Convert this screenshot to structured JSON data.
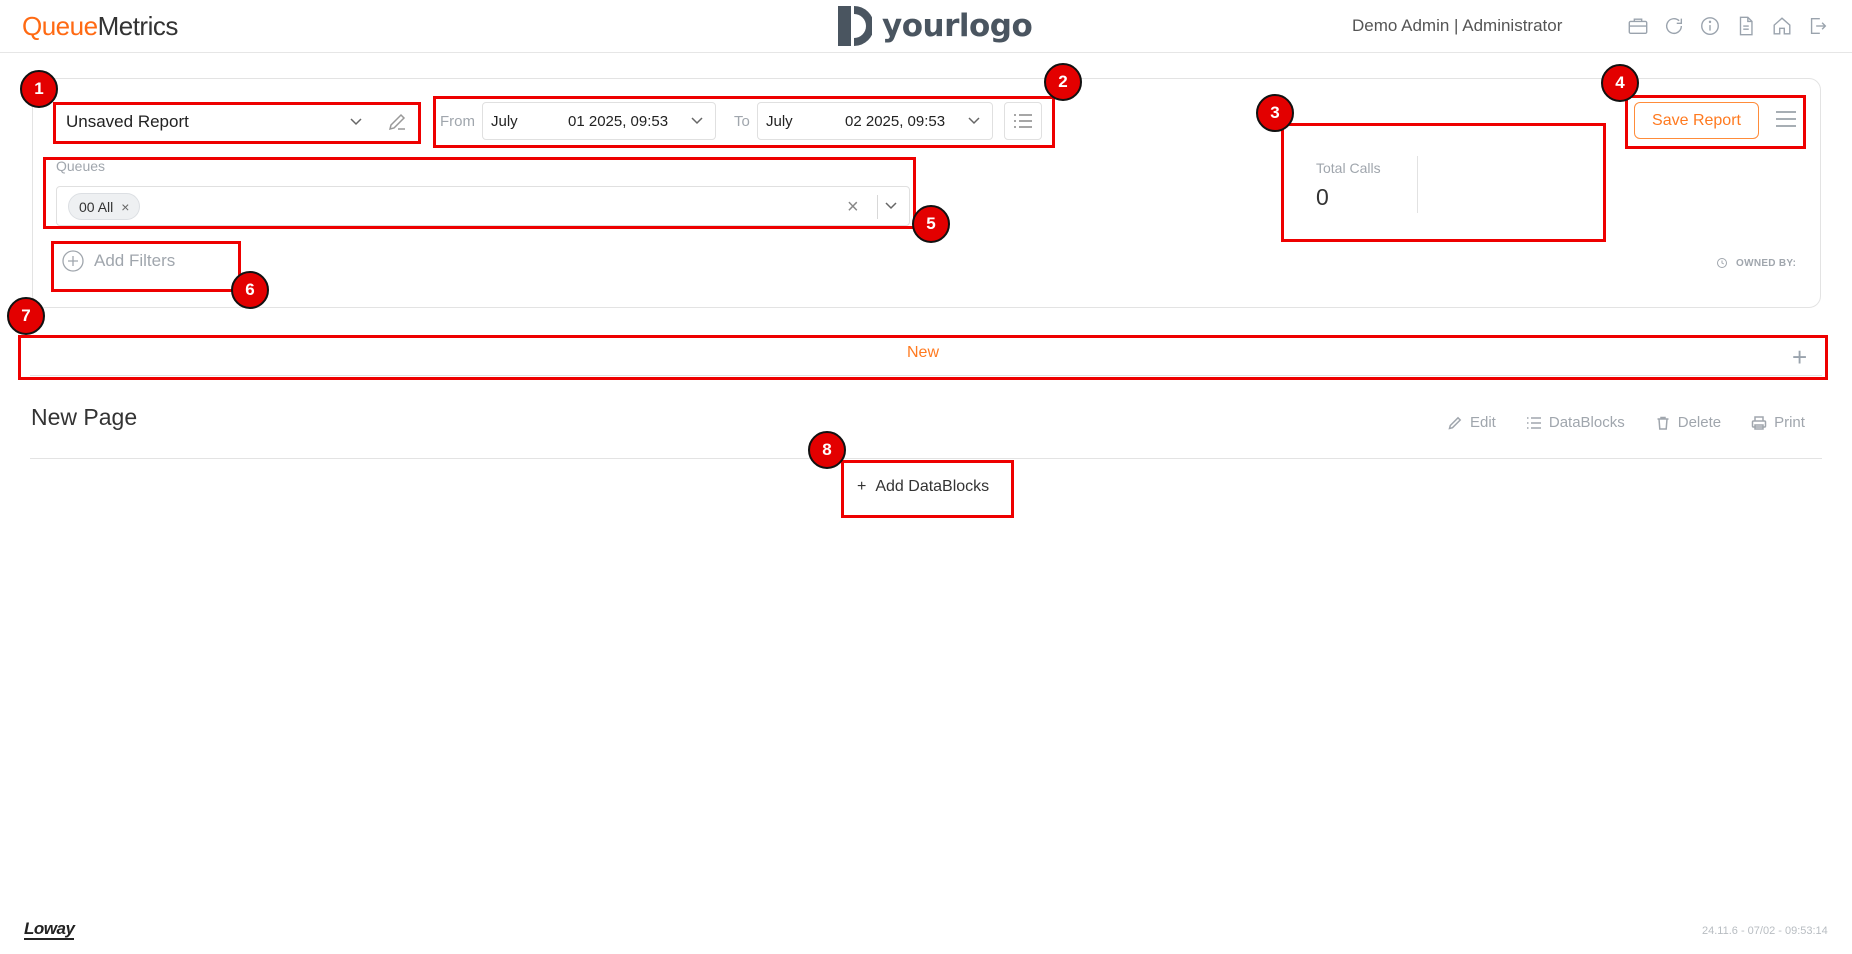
{
  "header": {
    "brand_part1": "Queue",
    "brand_part2": "Metrics",
    "center_logo": "yourlogo",
    "user": "Demo Admin | Administrator",
    "icons": [
      "briefcase-icon",
      "refresh-icon",
      "info-icon",
      "document-icon",
      "home-icon",
      "logout-icon"
    ]
  },
  "report": {
    "name": "Unsaved Report",
    "from_label": "From",
    "to_label": "To",
    "from_month": "July",
    "from_day": "01 2025, 09:53",
    "to_month": "July",
    "to_day": "02 2025, 09:53",
    "queues_label": "Queues",
    "queue_chip": "00 All",
    "add_filters": "Add Filters",
    "save_label": "Save Report",
    "owned_by": "OWNED BY:"
  },
  "stats": {
    "total_calls_label": "Total Calls",
    "total_calls_value": "0"
  },
  "tabs": [
    {
      "label": "New",
      "active": true
    }
  ],
  "page": {
    "title": "New Page",
    "actions": {
      "edit": "Edit",
      "datablocks": "DataBlocks",
      "delete": "Delete",
      "print": "Print"
    },
    "add_datablocks": "Add DataBlocks"
  },
  "footer": {
    "logo": "Loway",
    "version": "24.11.6 - 07/02 - 09:53:14"
  },
  "annotations": [
    "1",
    "2",
    "3",
    "4",
    "5",
    "6",
    "7",
    "8"
  ],
  "colors": {
    "accent": "#ff7a20",
    "annotation": "#e30000",
    "muted": "#a0a6ad"
  }
}
